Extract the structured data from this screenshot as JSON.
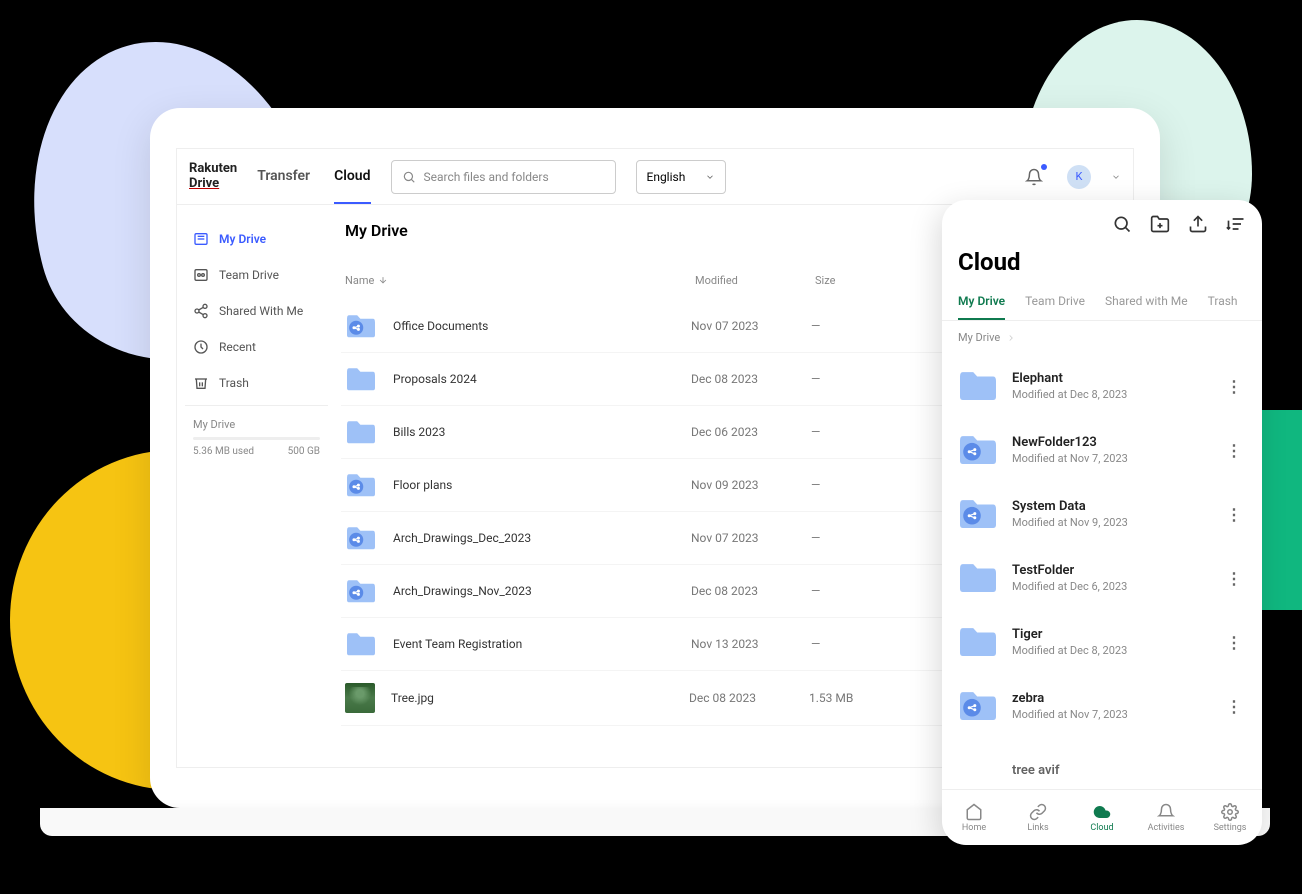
{
  "logo": {
    "line1": "Rakuten",
    "line2": "Drive"
  },
  "header": {
    "tabs": [
      "Transfer",
      "Cloud"
    ],
    "active_tab": 1,
    "search_placeholder": "Search files and folders",
    "language": "English",
    "avatar_initial": "K"
  },
  "sidebar": {
    "items": [
      {
        "label": "My Drive",
        "icon": "drive"
      },
      {
        "label": "Team Drive",
        "icon": "team"
      },
      {
        "label": "Shared With Me",
        "icon": "share"
      },
      {
        "label": "Recent",
        "icon": "clock"
      },
      {
        "label": "Trash",
        "icon": "trash"
      }
    ],
    "active": 0,
    "storage": {
      "title": "My Drive",
      "used": "5.36 MB used",
      "total": "500 GB"
    }
  },
  "main": {
    "title": "My Drive",
    "columns": {
      "name": "Name",
      "modified": "Modified",
      "size": "Size"
    },
    "files": [
      {
        "name": "Office Documents",
        "modified": "Nov 07 2023",
        "size": "—",
        "type": "shared-folder"
      },
      {
        "name": "Proposals 2024",
        "modified": "Dec 08 2023",
        "size": "—",
        "type": "folder"
      },
      {
        "name": "Bills 2023",
        "modified": "Dec 06 2023",
        "size": "—",
        "type": "folder"
      },
      {
        "name": "Floor plans",
        "modified": "Nov 09 2023",
        "size": "—",
        "type": "shared-folder"
      },
      {
        "name": "Arch_Drawings_Dec_2023",
        "modified": "Nov 07 2023",
        "size": "—",
        "type": "shared-folder"
      },
      {
        "name": "Arch_Drawings_Nov_2023",
        "modified": "Dec 08 2023",
        "size": "—",
        "type": "shared-folder"
      },
      {
        "name": "Event Team Registration",
        "modified": "Nov 13 2023",
        "size": "—",
        "type": "folder"
      },
      {
        "name": "Tree.jpg",
        "modified": "Dec 08 2023",
        "size": "1.53 MB",
        "type": "image"
      }
    ]
  },
  "mobile": {
    "title": "Cloud",
    "tabs": [
      "My Drive",
      "Team Drive",
      "Shared with Me",
      "Trash"
    ],
    "active_tab": 0,
    "breadcrumb": "My Drive",
    "items": [
      {
        "name": "Elephant",
        "meta": "Modified at Dec 8, 2023",
        "shared": false
      },
      {
        "name": "NewFolder123",
        "meta": "Modified at Nov 7, 2023",
        "shared": true
      },
      {
        "name": "System Data",
        "meta": "Modified at Nov 9, 2023",
        "shared": true
      },
      {
        "name": "TestFolder",
        "meta": "Modified at Dec 6, 2023",
        "shared": false
      },
      {
        "name": "Tiger",
        "meta": "Modified at Dec 8, 2023",
        "shared": false
      },
      {
        "name": "zebra",
        "meta": "Modified at Nov 7, 2023",
        "shared": true
      }
    ],
    "partial_item": "tree avif",
    "nav": [
      {
        "label": "Home",
        "icon": "home"
      },
      {
        "label": "Links",
        "icon": "link"
      },
      {
        "label": "Cloud",
        "icon": "cloud"
      },
      {
        "label": "Activities",
        "icon": "bell"
      },
      {
        "label": "Settings",
        "icon": "gear"
      }
    ],
    "active_nav": 2
  }
}
